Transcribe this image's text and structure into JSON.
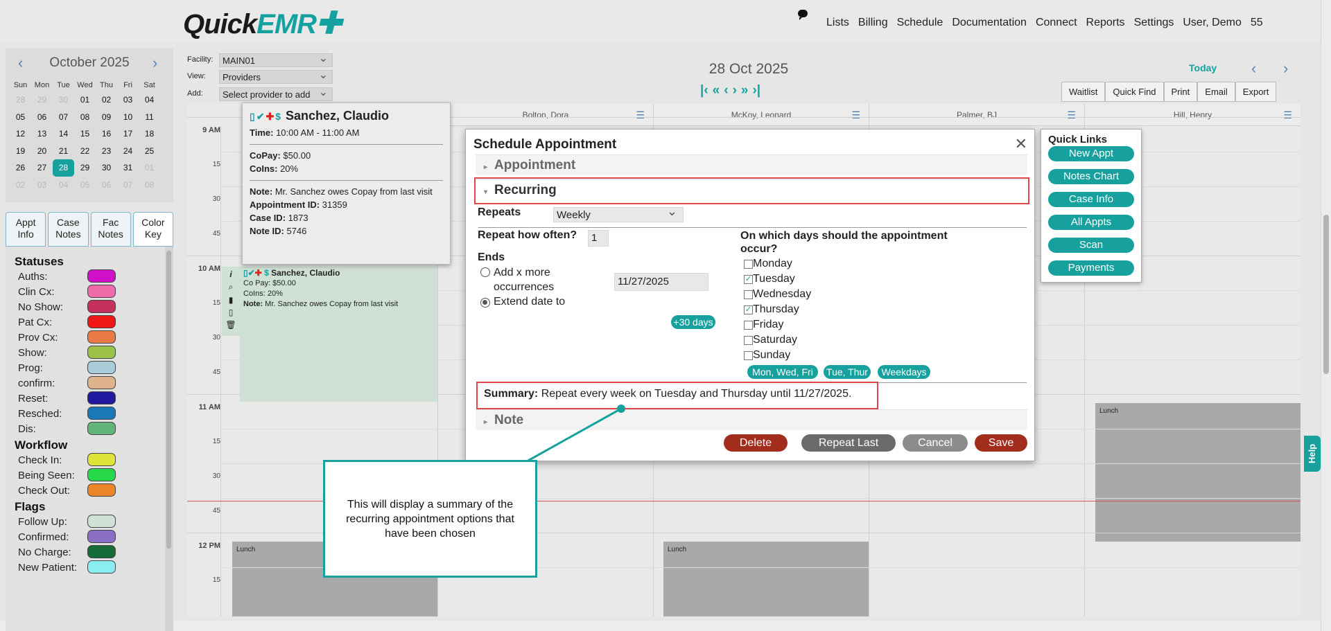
{
  "app": {
    "logo_quick": "Quick",
    "logo_emr": "EMR",
    "nav": [
      "Lists",
      "Billing",
      "Schedule",
      "Documentation",
      "Connect",
      "Reports",
      "Settings",
      "User, Demo",
      "55"
    ]
  },
  "minical": {
    "month_label": "October 2025",
    "dow": [
      "Sun",
      "Mon",
      "Tue",
      "Wed",
      "Thu",
      "Fri",
      "Sat"
    ],
    "weeks": [
      [
        "28",
        "29",
        "30",
        "01",
        "02",
        "03",
        "04"
      ],
      [
        "05",
        "06",
        "07",
        "08",
        "09",
        "10",
        "11"
      ],
      [
        "12",
        "13",
        "14",
        "15",
        "16",
        "17",
        "18"
      ],
      [
        "19",
        "20",
        "21",
        "22",
        "23",
        "24",
        "25"
      ],
      [
        "26",
        "27",
        "28",
        "29",
        "30",
        "31",
        "01"
      ],
      [
        "02",
        "03",
        "04",
        "05",
        "06",
        "07",
        "08"
      ]
    ],
    "selected": "28"
  },
  "left_tabs": [
    {
      "line1": "Appt",
      "line2": "Info"
    },
    {
      "line1": "Case",
      "line2": "Notes"
    },
    {
      "line1": "Fac",
      "line2": "Notes"
    },
    {
      "line1": "Color",
      "line2": "Key"
    }
  ],
  "legend": {
    "statuses_title": "Statuses",
    "statuses": [
      {
        "label": "Auths:",
        "color": "#d10fc9"
      },
      {
        "label": "Clin Cx:",
        "color": "#ef6aa9"
      },
      {
        "label": "No Show:",
        "color": "#c7305d"
      },
      {
        "label": "Pat Cx:",
        "color": "#ee1616"
      },
      {
        "label": "Prov Cx:",
        "color": "#ec7a46"
      },
      {
        "label": "Show:",
        "color": "#9cc24a"
      },
      {
        "label": "Prog:",
        "color": "#a7ccd8"
      },
      {
        "label": "confirm:",
        "color": "#dfb48c"
      },
      {
        "label": "Reset:",
        "color": "#221a9e"
      },
      {
        "label": "Resched:",
        "color": "#1a78b8"
      },
      {
        "label": "Dis:",
        "color": "#62b47a"
      }
    ],
    "workflow_title": "Workflow",
    "workflow": [
      {
        "label": "Check In:",
        "color": "#dfe43a"
      },
      {
        "label": "Being Seen:",
        "color": "#27d84b"
      },
      {
        "label": "Check Out:",
        "color": "#ec8428"
      }
    ],
    "flags_title": "Flags",
    "flags": [
      {
        "label": "Follow Up:",
        "color": "#cfe0d4"
      },
      {
        "label": "Confirmed:",
        "color": "#8a6fc4"
      },
      {
        "label": "No Charge:",
        "color": "#166b3a"
      },
      {
        "label": "New Patient:",
        "color": "#8aeef0"
      }
    ]
  },
  "controls": {
    "facility_label": "Facility:",
    "facility_value": "MAIN01",
    "view_label": "View:",
    "view_value": "Providers",
    "add_label": "Add:",
    "add_value": "Select provider to add"
  },
  "schedule": {
    "date_title": "28 Oct 2025",
    "today_label": "Today",
    "tools": [
      "Waitlist",
      "Quick Find",
      "Print",
      "Email",
      "Export"
    ],
    "columns": [
      "Bolton, Dora",
      "McKoy, Leonard",
      "Palmer, BJ",
      "Hill, Henry"
    ],
    "times": [
      "9 AM",
      "15",
      "30",
      "45",
      "10 AM",
      "15",
      "30",
      "45",
      "11 AM",
      "15",
      "30",
      "45",
      "12 PM",
      "15"
    ],
    "lunch_label": "Lunch",
    "appt": {
      "name": "Sanchez, Claudio",
      "copay": "Co Pay: $50.00",
      "coins": "CoIns: 20%",
      "note_label": "Note:",
      "note": "Mr. Sanchez owes Copay from last visit"
    }
  },
  "tooltip": {
    "name": "Sanchez, Claudio",
    "time_label": "Time:",
    "time": "10:00 AM - 11:00 AM",
    "copay_label": "CoPay:",
    "copay": "$50.00",
    "coins_label": "CoIns:",
    "coins": "20%",
    "note_label": "Note:",
    "note": "Mr. Sanchez owes Copay from last visit",
    "appt_id_label": "Appointment ID:",
    "appt_id": "31359",
    "case_id_label": "Case ID:",
    "case_id": "1873",
    "note_id_label": "Note ID:",
    "note_id": "5746"
  },
  "modal": {
    "title": "Schedule Appointment",
    "sections": {
      "appointment": "Appointment",
      "recurring": "Recurring",
      "note": "Note"
    },
    "repeats_label": "Repeats",
    "repeats_value": "Weekly",
    "repeat_often_label": "Repeat how often?",
    "repeat_often_value": "1",
    "ends_label": "Ends",
    "option_add": "Add x more occurrences",
    "option_extend": "Extend date to",
    "end_date": "11/27/2025",
    "plus30": "+30 days",
    "days_question": "On which days should the appointment occur?",
    "days": [
      {
        "label": "Monday",
        "checked": false
      },
      {
        "label": "Tuesday",
        "checked": true
      },
      {
        "label": "Wednesday",
        "checked": false
      },
      {
        "label": "Thursday",
        "checked": true
      },
      {
        "label": "Friday",
        "checked": false
      },
      {
        "label": "Saturday",
        "checked": false
      },
      {
        "label": "Sunday",
        "checked": false
      }
    ],
    "presets": [
      "Mon, Wed, Fri",
      "Tue, Thur",
      "Weekdays"
    ],
    "summary_label": "Summary:",
    "summary_text": "Repeat every week on Tuesday and Thursday until 11/27/2025.",
    "buttons": {
      "delete": "Delete",
      "repeat_last": "Repeat Last",
      "cancel": "Cancel",
      "save": "Save"
    },
    "colors": {
      "delete": "#a32d1d",
      "repeat_last": "#6b6b6b",
      "cancel": "#8c8c8c",
      "save": "#a32d1d"
    }
  },
  "quick_links": {
    "title": "Quick Links",
    "items": [
      "New Appt",
      "Notes Chart",
      "Case Info",
      "All Appts",
      "Scan",
      "Payments"
    ]
  },
  "callout": {
    "text": "This will display a summary of the recurring appointment options that have been chosen"
  },
  "help_label": "Help",
  "colors": {
    "accent": "#16a09e",
    "highlight": "#e04646"
  }
}
